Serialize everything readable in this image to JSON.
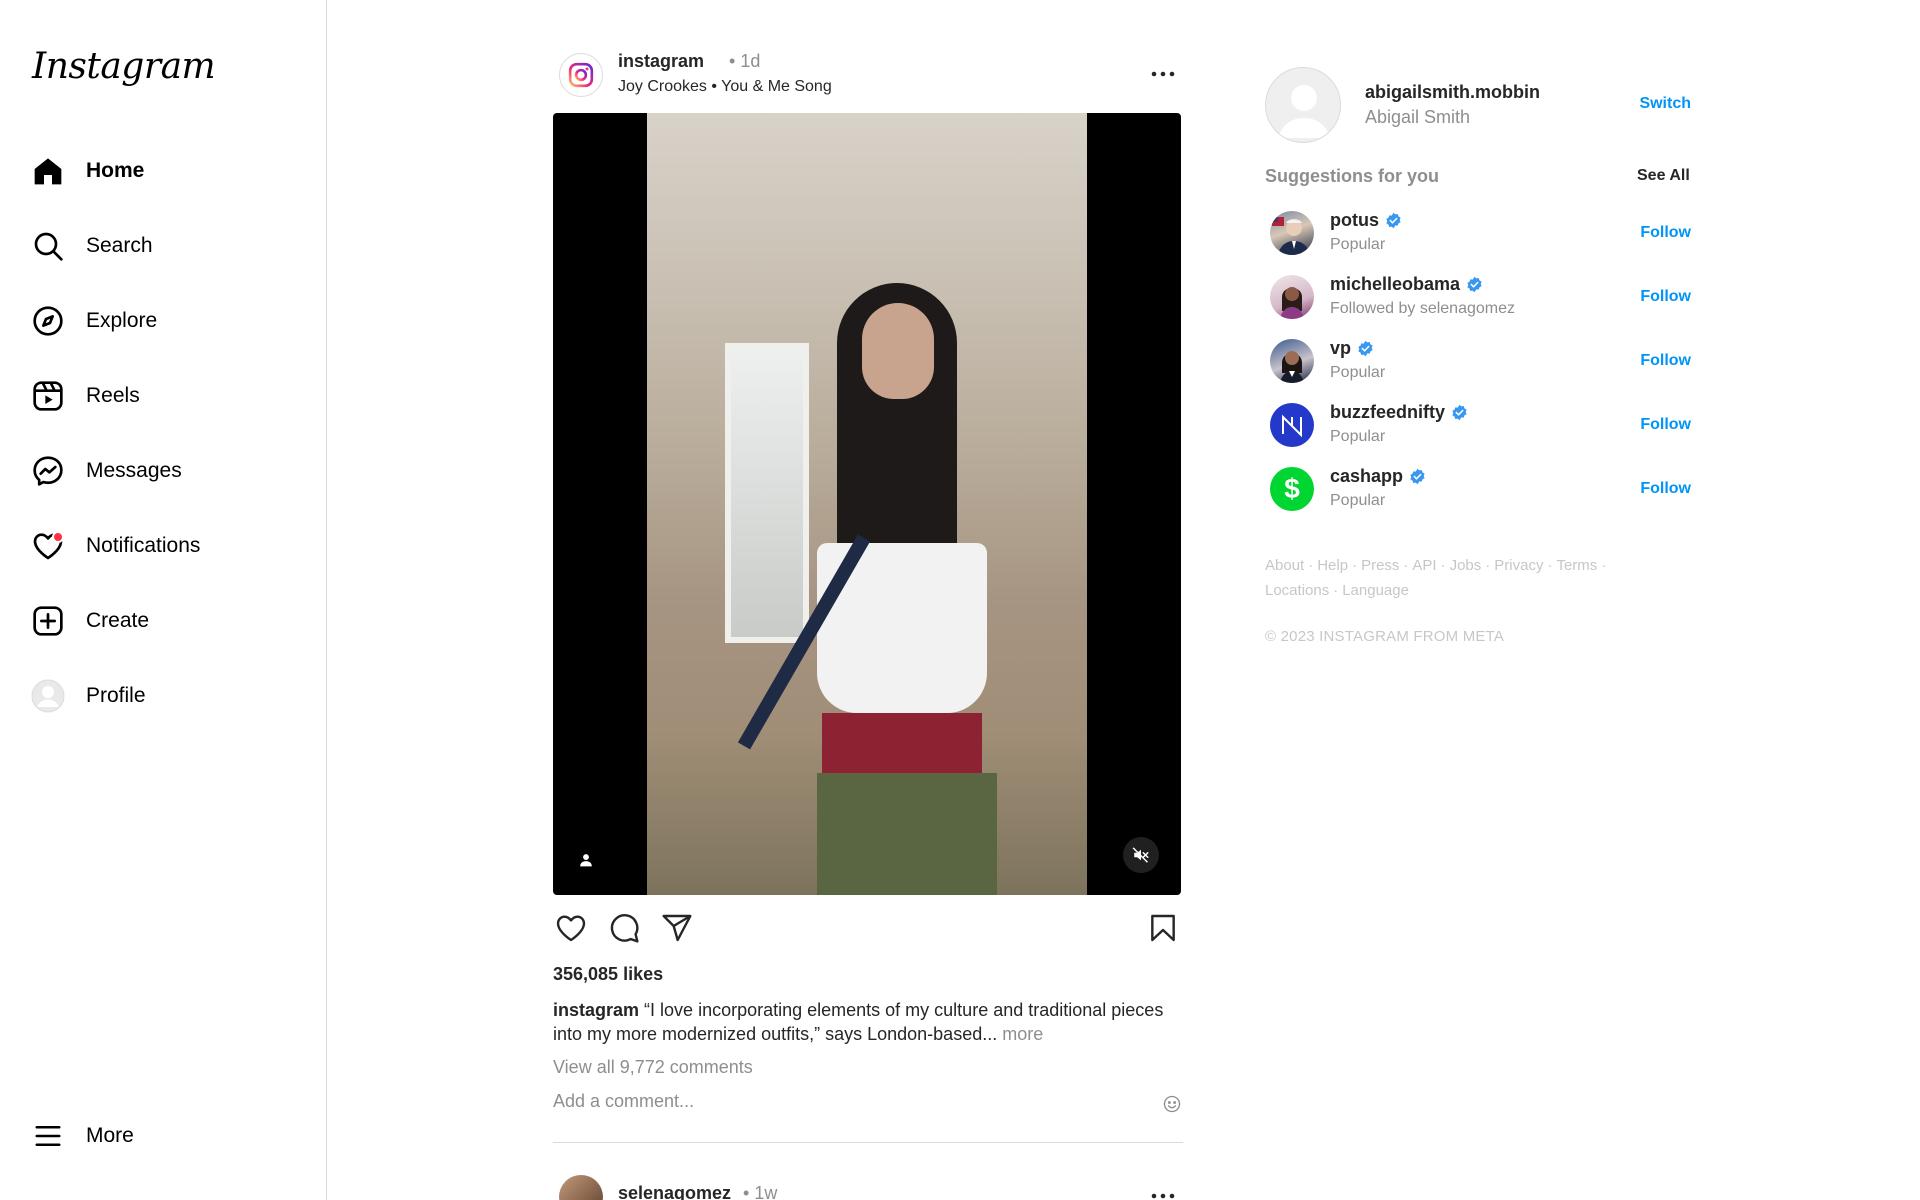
{
  "sidebar": {
    "logo": "Instagram",
    "items": [
      {
        "label": "Home",
        "icon": "home-icon"
      },
      {
        "label": "Search",
        "icon": "search-icon"
      },
      {
        "label": "Explore",
        "icon": "compass-icon"
      },
      {
        "label": "Reels",
        "icon": "reels-icon"
      },
      {
        "label": "Messages",
        "icon": "messenger-icon"
      },
      {
        "label": "Notifications",
        "icon": "heart-icon"
      },
      {
        "label": "Create",
        "icon": "plus-square-icon"
      },
      {
        "label": "Profile",
        "icon": "avatar"
      }
    ],
    "more_label": "More"
  },
  "post": {
    "username": "instagram",
    "time": "1d",
    "audio_artist": "Joy Crookes",
    "audio_song": "You & Me Song",
    "likes": "356,085 likes",
    "caption_user": "instagram",
    "caption_text": "“I love incorporating elements of my culture and traditional pieces into my more modernized outfits,” says London-based...",
    "caption_more": "more",
    "view_comments": "View all 9,772 comments",
    "comment_placeholder": "Add a comment..."
  },
  "next_post": {
    "username": "selenagomez",
    "time": "1w"
  },
  "account": {
    "username": "abigailsmith.mobbin",
    "name": "Abigail Smith",
    "switch_label": "Switch"
  },
  "suggestions": {
    "title": "Suggestions for you",
    "see_all": "See All",
    "follow_label": "Follow",
    "items": [
      {
        "username": "potus",
        "subtitle": "Popular"
      },
      {
        "username": "michelleobama",
        "subtitle": "Followed by selenagomez"
      },
      {
        "username": "vp",
        "subtitle": "Popular"
      },
      {
        "username": "buzzfeednifty",
        "subtitle": "Popular"
      },
      {
        "username": "cashapp",
        "subtitle": "Popular"
      }
    ]
  },
  "footer": {
    "links": [
      "About",
      "Help",
      "Press",
      "API",
      "Jobs",
      "Privacy",
      "Terms",
      "Locations",
      "Language"
    ],
    "copyright": "© 2023 INSTAGRAM FROM META"
  },
  "colors": {
    "link_blue": "#0095f6",
    "notification_dot": "#ff3040",
    "verified_blue": "#3897f0",
    "cashapp_green": "#00d632",
    "buzzfeed_blue": "#2438c9"
  }
}
